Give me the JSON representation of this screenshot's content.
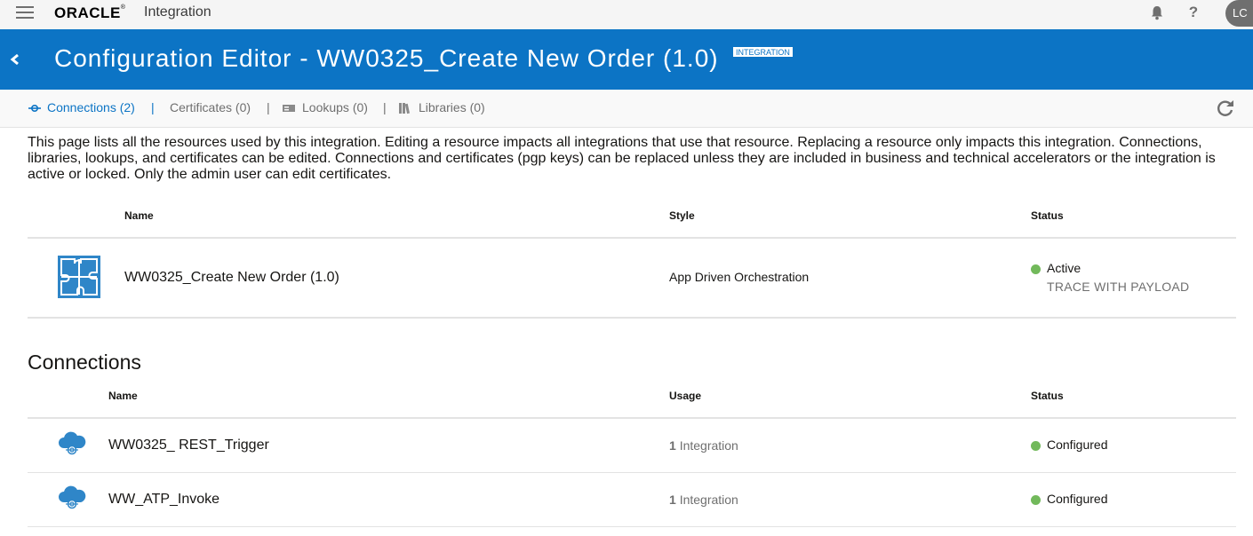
{
  "app": {
    "brand": "ORACLE",
    "brand_mark": "®",
    "product": "Integration",
    "user_initials": "LC",
    "help_glyph": "?"
  },
  "header": {
    "title": "Configuration Editor - WW0325_Create New Order (1.0)",
    "badge": "INTEGRATION"
  },
  "tabs": [
    {
      "label": "Connections (2)",
      "icon": "connection-icon",
      "active": true
    },
    {
      "label": "Certificates (0)",
      "icon": "",
      "active": false
    },
    {
      "label": "Lookups (0)",
      "icon": "lookup-icon",
      "active": false
    },
    {
      "label": "Libraries (0)",
      "icon": "library-icon",
      "active": false
    }
  ],
  "tab_separator": "|",
  "description": "This page lists all the resources used by this integration. Editing a resource impacts all integrations that use that resource. Replacing a resource only impacts this integration. Connections, libraries, lookups, and certificates can be edited. Connections and certificates (pgp keys) can be replaced unless they are included in business and technical accelerators or the integration is active or locked. Only the admin user can edit certificates.",
  "integration_table": {
    "columns": {
      "name": "Name",
      "style": "Style",
      "status": "Status"
    },
    "row": {
      "icon": "puzzle-icon",
      "name": "WW0325_Create New Order (1.0)",
      "style": "App Driven Orchestration",
      "status": "Active",
      "trace": "TRACE WITH PAYLOAD"
    }
  },
  "connections": {
    "title": "Connections",
    "columns": {
      "name": "Name",
      "usage": "Usage",
      "status": "Status"
    },
    "rows": [
      {
        "icon": "rest-cloud-icon",
        "name": "WW0325_ REST_Trigger",
        "usage_count": "1",
        "usage_label": "Integration",
        "status": "Configured"
      },
      {
        "icon": "rest-cloud-icon",
        "name": "WW_ATP_Invoke",
        "usage_count": "1",
        "usage_label": "Integration",
        "status": "Configured"
      }
    ]
  },
  "colors": {
    "header_blue": "#0c74c5",
    "status_green": "#72b95b",
    "icon_blue": "#2f86c8"
  }
}
